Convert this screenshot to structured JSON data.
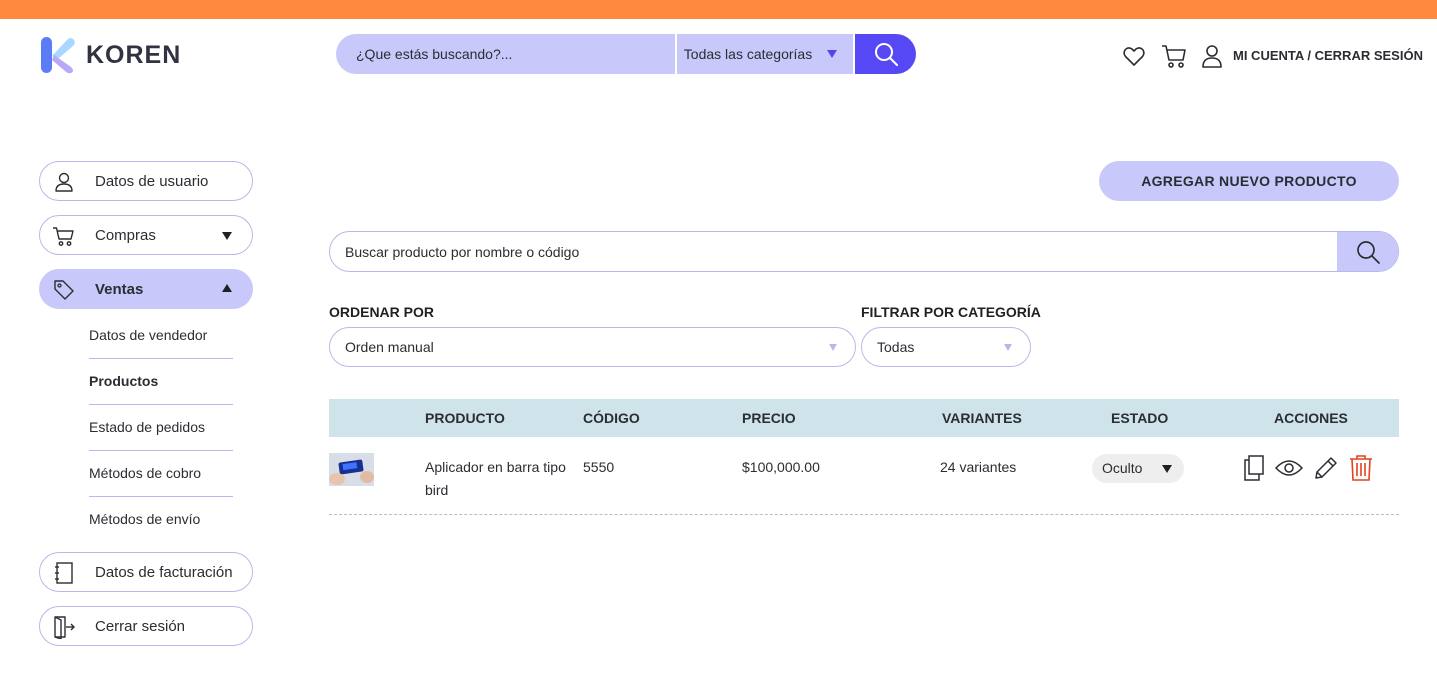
{
  "brand": {
    "name": "KOREN",
    "accent": "#ff8a3d",
    "primary": "#5649f5",
    "soft": "#c9c8fb"
  },
  "header": {
    "search_placeholder": "¿Que estás buscando?...",
    "category_select": "Todas las categorías",
    "account_link": "MI CUENTA / CERRAR SESIÓN",
    "icons": [
      "heart-icon",
      "cart-icon",
      "user-icon",
      "search-icon"
    ]
  },
  "sidebar": {
    "items": [
      {
        "label": "Datos de usuario",
        "icon": "user-icon"
      },
      {
        "label": "Compras",
        "icon": "cart-icon",
        "expanded": false
      },
      {
        "label": "Ventas",
        "icon": "tag-icon",
        "expanded": true,
        "active": true
      },
      {
        "label": "Datos de facturación",
        "icon": "notebook-icon"
      },
      {
        "label": "Cerrar sesión",
        "icon": "logout-icon"
      }
    ],
    "ventas_sub": [
      "Datos de vendedor",
      "Productos",
      "Estado de pedidos",
      "Métodos de cobro",
      "Métodos de envío"
    ],
    "current_sub": "Productos"
  },
  "main": {
    "add_button": "AGREGAR NUEVO PRODUCTO",
    "search_placeholder": "Buscar producto por nombre o código",
    "sort_label": "ORDENAR POR",
    "sort_value": "Orden manual",
    "filter_label": "FILTRAR POR CATEGORÍA",
    "filter_value": "Todas",
    "columns": [
      "PRODUCTO",
      "CÓDIGO",
      "PRECIO",
      "VARIANTES",
      "ESTADO",
      "ACCIONES"
    ],
    "rows": [
      {
        "product": "Aplicador en barra tipo bird",
        "code": "5550",
        "price": "$100,000.00",
        "variants": "24 variantes",
        "status": "Oculto",
        "actions": [
          "copy-icon",
          "eye-icon",
          "pencil-icon",
          "trash-icon"
        ]
      }
    ]
  }
}
